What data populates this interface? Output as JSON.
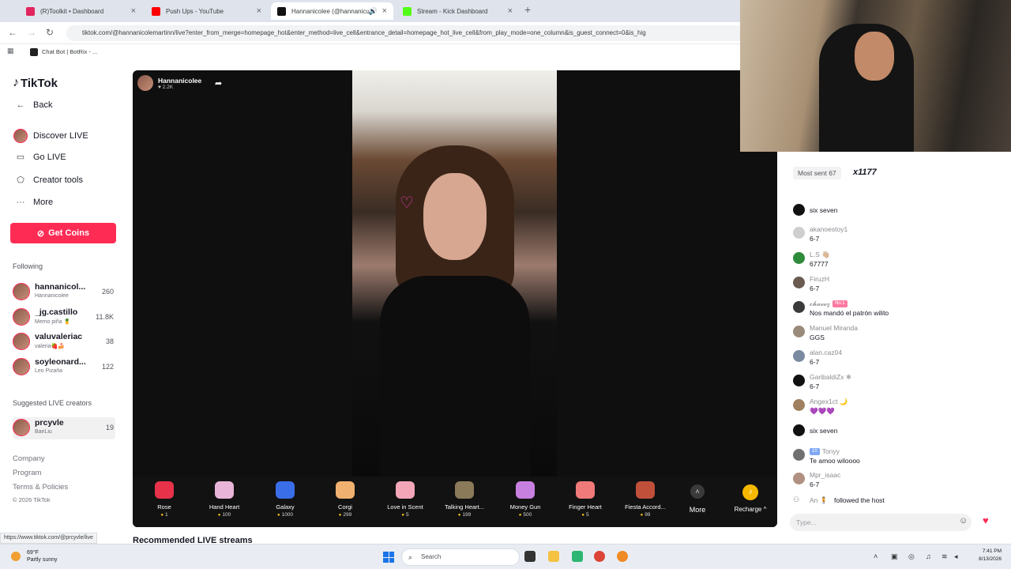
{
  "browser": {
    "tabs": [
      {
        "label": "(R)Toolkit • Dashboard",
        "color": "#e0245e"
      },
      {
        "label": "Push Ups - YouTube",
        "color": "#ff0000"
      },
      {
        "label": "Hannanicolee (@hannanicu",
        "color": "#111111"
      },
      {
        "label": "Stream - Kick Dashboard",
        "color": "#53fc18"
      }
    ],
    "url": "tiktok.com/@hannanicolemartinn/live?enter_from_merge=homepage_hot&enter_method=live_cell&entrance_detail=homepage_hot_live_cell&from_play_mode=one_column&is_guest_connect=0&is_hig",
    "bookmark": "Chat Bot | BotRix - ..."
  },
  "sidebar": {
    "logo": "TikTok",
    "back": "Back",
    "nav": [
      {
        "label": "Discover LIVE",
        "icon": "avatar"
      },
      {
        "label": "Go LIVE",
        "icon": "camera-icon"
      },
      {
        "label": "Creator tools",
        "icon": "creator-icon"
      },
      {
        "label": "More",
        "icon": "more-icon"
      }
    ],
    "get_coins": "Get Coins",
    "following_title": "Following",
    "following": [
      {
        "name": "hannanicol...",
        "sub": "Hannanicolee",
        "count": "260"
      },
      {
        "name": "_jg.castillo",
        "sub": "Memo piña 🍍",
        "count": "11.8K"
      },
      {
        "name": "valuvaleriac",
        "sub": "valeria🍓🍰",
        "count": "38"
      },
      {
        "name": "soyleonard...",
        "sub": "Leo Pizaña",
        "count": "122"
      }
    ],
    "suggested_title": "Suggested LIVE creators",
    "suggested": [
      {
        "name": "prcyvle",
        "sub": "BaeLiu",
        "count": "19"
      }
    ],
    "footer": [
      "Company",
      "Program",
      "Terms & Policies",
      "© 2026 TikTok"
    ]
  },
  "stage": {
    "host_name": "Hannanicolee",
    "host_likes": "♥ 2.2K",
    "gifts": [
      {
        "name": "Rose",
        "price": "1",
        "color": "#e8324a"
      },
      {
        "name": "Hand Heart",
        "price": "100",
        "color": "#e8b4d8"
      },
      {
        "name": "Galaxy",
        "price": "1000",
        "color": "#3a6ee8"
      },
      {
        "name": "Corgi",
        "price": "299",
        "color": "#f0b070"
      },
      {
        "name": "Love in Scent",
        "price": "5",
        "color": "#f3a6b8"
      },
      {
        "name": "Talking Heart...",
        "price": "199",
        "color": "#8a7a5a"
      },
      {
        "name": "Money Gun",
        "price": "500",
        "color": "#c880e0"
      },
      {
        "name": "Finger Heart",
        "price": "5",
        "color": "#f07a7a"
      },
      {
        "name": "Fiesta Accord...",
        "price": "99",
        "color": "#c0503a"
      }
    ],
    "more_label": "More",
    "recharge_label": "Recharge ^"
  },
  "recommended_label": "Recommended LIVE streams",
  "status_url": "https://www.tiktok.com/@prcyvle/live",
  "chat": {
    "most_sent_label": "Most sent 67",
    "most_sent_count": "x1177",
    "messages": [
      {
        "user": "",
        "text": "six seven",
        "avatar": "#111111"
      },
      {
        "user": "akanoestoy1",
        "text": "6-7",
        "avatar": "#cfcfcf"
      },
      {
        "user": "L.S 👋🏼",
        "text": "67777",
        "avatar": "#2e8b3a"
      },
      {
        "user": "FiruzH",
        "text": "6-7",
        "avatar": "#6a5a50"
      },
      {
        "user": "𝓬𝓱𝓪𝓮𝓮𝔃",
        "badge": "No.1",
        "text": "Nos mandó el patrón wilito",
        "avatar": "#3a3a3a"
      },
      {
        "user": "Manuel Miranda",
        "text": "GGS",
        "avatar": "#9a8a7a"
      },
      {
        "user": "alan.caz04",
        "text": "6-7",
        "avatar": "#7a8aa0"
      },
      {
        "user": "GaribaldiZx ❄",
        "text": "6-7",
        "avatar": "#111111"
      },
      {
        "user": "Angex1ct 🌙",
        "text": "💜💜💜",
        "avatar": "#a08060"
      },
      {
        "user": "",
        "text": "six seven",
        "avatar": "#111111"
      },
      {
        "user": "Tonyy",
        "badge_blue": "10",
        "text": "Te amoo wiloooo",
        "avatar": "#707070"
      },
      {
        "user": "Mpr_isaac",
        "text": "6-7",
        "avatar": "#b09080"
      },
      {
        "user": "An 🧍",
        "text": "followed the host",
        "avatar": "#ffffff"
      }
    ],
    "input_placeholder": "Type..."
  },
  "taskbar": {
    "temp": "69°F",
    "weather": "Partly sunny",
    "search": "Search",
    "time": "7:41 PM",
    "date": "8/13/2026"
  }
}
